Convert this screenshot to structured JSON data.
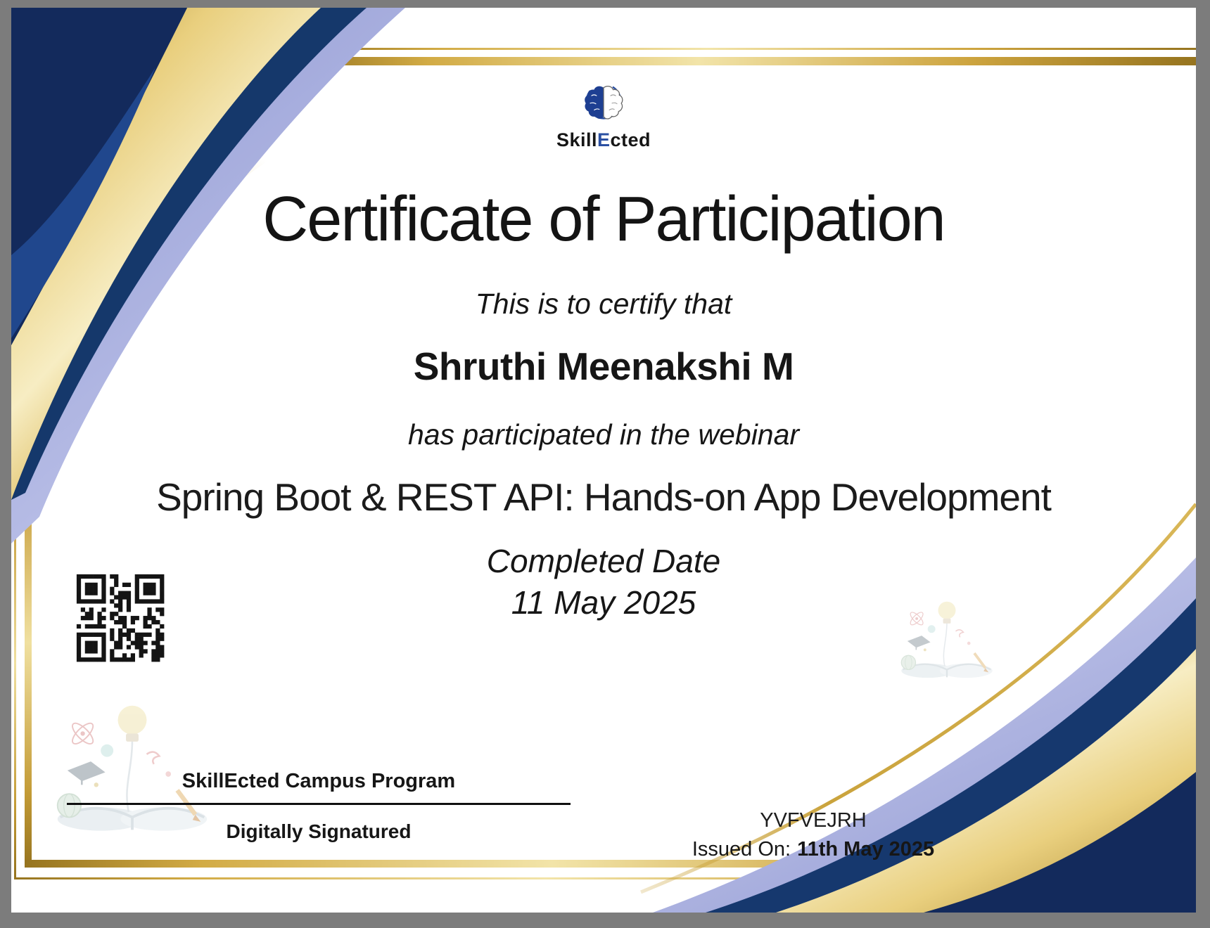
{
  "brand": {
    "logo": {
      "pre": "Skill",
      "accent": "E",
      "post": "cted"
    }
  },
  "certificate": {
    "title": "Certificate of Participation",
    "certify_line": "This is to certify that",
    "recipient_name": "Shruthi Meenakshi M",
    "participation_line": "has participated in the webinar",
    "webinar_title": "Spring Boot & REST API: Hands-on App Development",
    "completed_label": "Completed Date",
    "completed_date": "11 May 2025"
  },
  "footer": {
    "issuer_program": "SkillEcted Campus Program",
    "signature_label": "Digitally Signatured",
    "certificate_code": "YVFVEJRH",
    "issued_on_label": "Issued On:",
    "issued_on_date": "11th May 2025"
  },
  "colors": {
    "navy": "#132a5c",
    "royal_blue": "#20478d",
    "gold": "#d4ac46",
    "lavender": "#a9b0df",
    "logo_accent_blue": "#2a4fa2",
    "surround_gray": "#7c7c7c"
  }
}
